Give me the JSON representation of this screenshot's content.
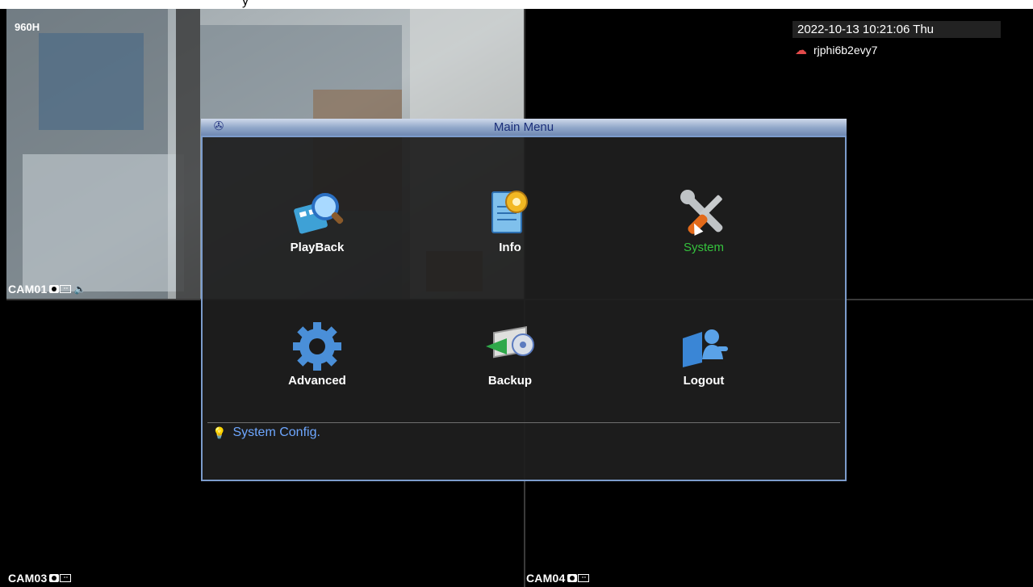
{
  "overlay": {
    "top_left_label": "960H",
    "datetime": "2022-10-13 10:21:06 Thu",
    "device_id": "rjphi6b2evy7"
  },
  "cameras": [
    {
      "label": "CAM01"
    },
    {
      "label": "CAM03"
    },
    {
      "label": "CAM04"
    }
  ],
  "menu": {
    "title": "Main Menu",
    "items": [
      {
        "label": "PlayBack",
        "icon": "playback-search-icon"
      },
      {
        "label": "Info",
        "icon": "info-gear-doc-icon"
      },
      {
        "label": "System",
        "icon": "system-tools-icon",
        "active": true
      },
      {
        "label": "Advanced",
        "icon": "advanced-gear-icon"
      },
      {
        "label": "Backup",
        "icon": "backup-disc-icon"
      },
      {
        "label": "Logout",
        "icon": "logout-user-icon"
      }
    ],
    "hint": "System Config."
  },
  "colors": {
    "active_item": "#35c23d",
    "hint_text": "#6ea7ff",
    "title_bar": "#8fa6c8"
  }
}
